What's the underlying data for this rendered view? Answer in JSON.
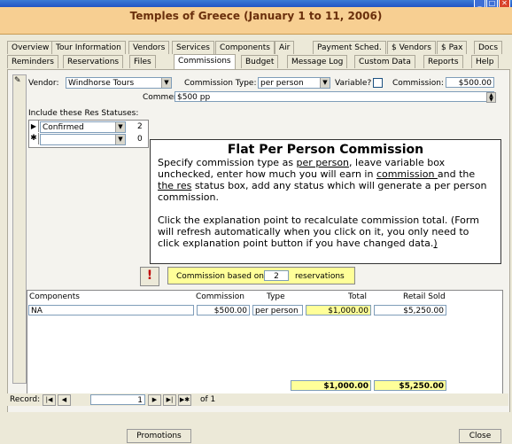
{
  "window": {
    "title": "Temples of Greece (January 1 to 11, 2006)",
    "controls": [
      "minimize",
      "maximize",
      "close"
    ]
  },
  "tabs_row1": [
    "Overview",
    "Tour Information",
    "Vendors",
    "Services",
    "Components",
    "Air",
    "Payment Sched.",
    "$ Vendors",
    "$ Pax",
    "Docs"
  ],
  "tabs_row2": [
    "Reminders",
    "Reservations",
    "Files",
    "Commissions",
    "Budget",
    "Message Log",
    "Custom Data",
    "Reports",
    "Help"
  ],
  "active_tab": "Commissions",
  "form": {
    "vendor_label": "Vendor:",
    "vendor_value": "Windhorse Tours",
    "commission_type_label": "Commission Type:",
    "commission_type_value": "per person",
    "variable_label": "Variable?",
    "variable_checked": false,
    "commission_label": "Commission:",
    "commission_value": "$500.00",
    "comment_label": "Comment:",
    "comment_value": "$500 pp",
    "res_statuses_label": "Include these Res Statuses:",
    "res_statuses": [
      {
        "status": "Confirmed",
        "count": "2"
      },
      {
        "status": "",
        "count": "0"
      }
    ]
  },
  "explanation": {
    "title": "Flat Per Person Commission",
    "p1_a": "Specify commission type as ",
    "p1_u1": "per person",
    "p1_b": ", leave variable box unchecked, enter how much you will earn in ",
    "p1_u2": "commission ",
    "p1_c": "and the ",
    "p1_u3": "the res",
    "p1_d": " status box, add any status which will generate a per person commission.",
    "p2": "Click the explanation point to recalculate commission total. (Form will refresh automatically when you click on it, you only need to click explanation point button if you have changed data.",
    "p2_end": ")"
  },
  "recalc_button_symbol": "!",
  "commission_basis": {
    "prefix": "Commission based on",
    "count": "2",
    "suffix": "reservations"
  },
  "components_table": {
    "headers": [
      "Components",
      "Commission",
      "Type",
      "Total",
      "Retail Sold"
    ],
    "rows": [
      [
        "NA",
        "$500.00",
        "per person",
        "$1,000.00",
        "$5,250.00"
      ]
    ],
    "totals": {
      "total": "$1,000.00",
      "retail_sold": "$5,250.00"
    }
  },
  "record_nav": {
    "label": "Record:",
    "current": "1",
    "of_text": "of 1"
  },
  "bottom_buttons": {
    "promotions": "Promotions",
    "close": "Close"
  },
  "colors": {
    "header_bg": "#f7cf92",
    "header_text": "#6a2f0c",
    "highlight": "#ffff99",
    "recalc": "#c00000"
  }
}
